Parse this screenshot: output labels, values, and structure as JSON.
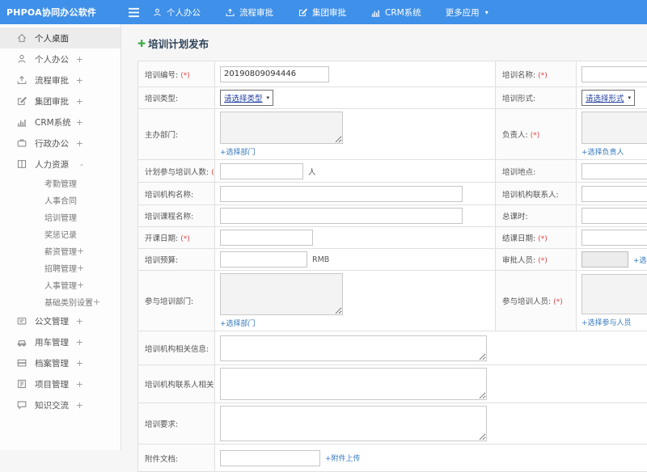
{
  "colors": {
    "navbar_bg": "#3f90e8",
    "link_blue": "#3678bd",
    "required_red": "#e04343",
    "title_navy": "#2e4358",
    "plus_green": "#3fae49"
  },
  "icons": {
    "plus": "✚",
    "caret": "▾"
  },
  "topbar": {
    "brand": "PHPOA协同办公软件",
    "items": [
      {
        "icon": "user",
        "label": "个人办公"
      },
      {
        "icon": "flow",
        "label": "流程审批"
      },
      {
        "icon": "edit",
        "label": "集团审批"
      },
      {
        "icon": "chart",
        "label": "CRM系统"
      },
      {
        "icon": "",
        "label": "更多应用",
        "caret": true
      }
    ]
  },
  "sidebar": {
    "items": [
      {
        "icon": "home",
        "label": "个人桌面",
        "suffix": "",
        "active": true,
        "sub": false
      },
      {
        "icon": "user",
        "label": "个人办公",
        "suffix": "+",
        "active": false,
        "sub": false
      },
      {
        "icon": "flow",
        "label": "流程审批",
        "suffix": "+",
        "active": false,
        "sub": false
      },
      {
        "icon": "edit",
        "label": "集团审批",
        "suffix": "+",
        "active": false,
        "sub": false
      },
      {
        "icon": "chart",
        "label": "CRM系统",
        "suffix": "+",
        "active": false,
        "sub": false
      },
      {
        "icon": "briefcase",
        "label": "行政办公",
        "suffix": "+",
        "active": false,
        "sub": false
      },
      {
        "icon": "hr",
        "label": "人力资源",
        "suffix": "-",
        "active": false,
        "sub": false
      },
      {
        "icon": "",
        "label": "考勤管理",
        "suffix": "",
        "active": false,
        "sub": true
      },
      {
        "icon": "",
        "label": "人事合同",
        "suffix": "",
        "active": false,
        "sub": true
      },
      {
        "icon": "",
        "label": "培训管理",
        "suffix": "",
        "active": false,
        "sub": true
      },
      {
        "icon": "",
        "label": "奖惩记录",
        "suffix": "",
        "active": false,
        "sub": true
      },
      {
        "icon": "",
        "label": "薪资管理",
        "suffix": "+",
        "active": false,
        "sub": true
      },
      {
        "icon": "",
        "label": "招聘管理",
        "suffix": "+",
        "active": false,
        "sub": true
      },
      {
        "icon": "",
        "label": "人事管理",
        "suffix": "+",
        "active": false,
        "sub": true
      },
      {
        "icon": "",
        "label": "基础类别设置",
        "suffix": "+",
        "active": false,
        "sub": true
      },
      {
        "icon": "doc",
        "label": "公文管理",
        "suffix": "+",
        "active": false,
        "sub": false
      },
      {
        "icon": "car",
        "label": "用车管理",
        "suffix": "+",
        "active": false,
        "sub": false
      },
      {
        "icon": "archive",
        "label": "档案管理",
        "suffix": "+",
        "active": false,
        "sub": false
      },
      {
        "icon": "project",
        "label": "项目管理",
        "suffix": "+",
        "active": false,
        "sub": false
      },
      {
        "icon": "chat",
        "label": "知识交流",
        "suffix": "+",
        "active": false,
        "sub": false
      }
    ]
  },
  "page": {
    "title": "培训计划发布"
  },
  "form": {
    "required_mark": "(*)",
    "training_no": {
      "label": "培训编号:",
      "value": "20190809094446"
    },
    "training_name": {
      "label": "培训名称:",
      "value": ""
    },
    "training_type": {
      "label": "培训类型:",
      "selected": "请选择类型"
    },
    "training_form": {
      "label": "培训形式:",
      "selected": "请选择形式"
    },
    "host_dept": {
      "label": "主办部门:",
      "link": "+选择部门"
    },
    "leader": {
      "label": "负责人:",
      "link": "+选择负责人"
    },
    "planned_count": {
      "label": "计划参与培训人数:",
      "value": "",
      "suffix": "人"
    },
    "location": {
      "label": "培训地点:",
      "value": ""
    },
    "org_name": {
      "label": "培训机构名称:",
      "value": ""
    },
    "org_contact": {
      "label": "培训机构联系人:",
      "value": ""
    },
    "course_name": {
      "label": "培训课程名称:",
      "value": ""
    },
    "total_hours": {
      "label": "总课时:",
      "value": ""
    },
    "start_date": {
      "label": "开课日期:",
      "value": ""
    },
    "end_date": {
      "label": "结课日期:",
      "value": ""
    },
    "budget": {
      "label": "培训预算:",
      "value": "",
      "suffix": "RMB"
    },
    "approver": {
      "label": "审批人员:",
      "value": "",
      "link": "+选择审批人员"
    },
    "part_dept": {
      "label": "参与培训部门:",
      "link": "+选择部门"
    },
    "part_person": {
      "label": "参与培训人员:",
      "link": "+选择参与人员"
    },
    "org_info": {
      "label": "培训机构相关信息:"
    },
    "org_contact_info": {
      "label": "培训机构联系人相关信息:"
    },
    "requirement": {
      "label": "培训要求:"
    },
    "attachment": {
      "label": "附件文档:",
      "value": "",
      "link": "+附件上传"
    }
  }
}
